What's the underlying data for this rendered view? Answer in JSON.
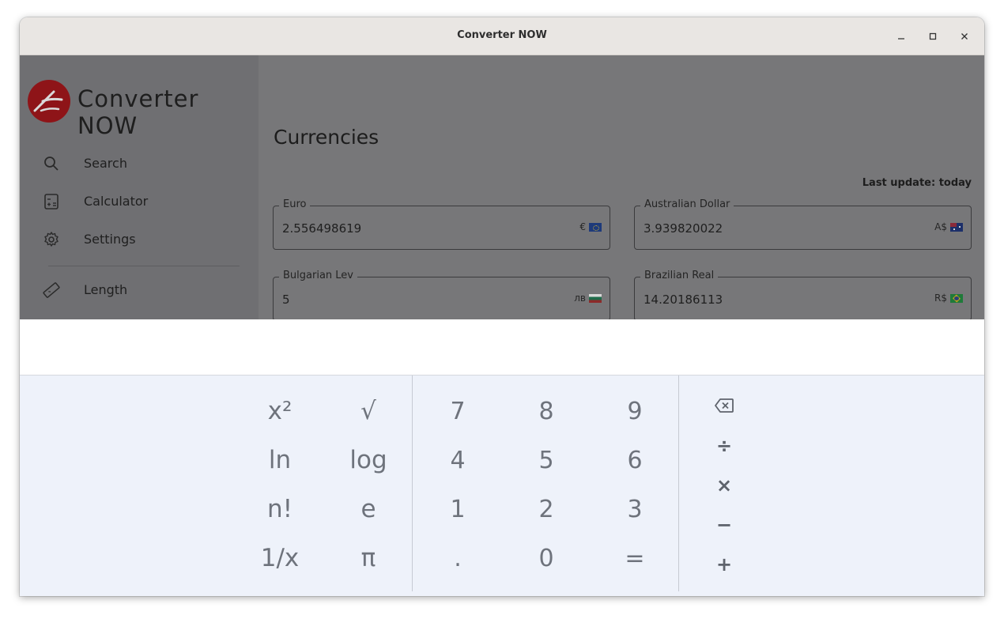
{
  "window": {
    "title": "Converter NOW",
    "controls": {
      "minimize": "–",
      "maximize": "□",
      "close": "×"
    }
  },
  "drawer": {
    "brand": "Converter NOW",
    "items": [
      {
        "label": "Search",
        "icon": "search-icon"
      },
      {
        "label": "Calculator",
        "icon": "calculator-icon"
      },
      {
        "label": "Settings",
        "icon": "gear-icon"
      },
      {
        "label": "Length",
        "icon": "ruler-icon"
      }
    ]
  },
  "main": {
    "title": "Currencies",
    "last_update": "Last update: today",
    "fields": [
      {
        "label": "Euro",
        "value": "2.556498619",
        "symbol": "€",
        "flag": "eu-flag-icon"
      },
      {
        "label": "Australian Dollar",
        "value": "3.939820022",
        "symbol": "A$",
        "flag": "au-flag-icon"
      },
      {
        "label": "Bulgarian Lev",
        "value": "5",
        "symbol": "лв",
        "flag": "bg-flag-icon"
      },
      {
        "label": "Brazilian Real",
        "value": "14.20186113",
        "symbol": "R$",
        "flag": "br-flag-icon"
      }
    ]
  },
  "calculator": {
    "display": "",
    "scientific": [
      [
        "x²",
        "√"
      ],
      [
        "ln",
        "log"
      ],
      [
        "n!",
        "e"
      ],
      [
        "1/x",
        "π"
      ]
    ],
    "digits": [
      [
        "7",
        "8",
        "9"
      ],
      [
        "4",
        "5",
        "6"
      ],
      [
        "1",
        "2",
        "3"
      ],
      [
        ".",
        "0",
        "="
      ]
    ],
    "operators": [
      "⌫",
      "÷",
      "×",
      "−",
      "+"
    ]
  },
  "colors": {
    "dim_overlay": "#777779",
    "drawer": "#6f6f72",
    "keypad_bg": "#eef2fa",
    "key_text": "#6e737c",
    "logo_red": "#b5121b"
  }
}
